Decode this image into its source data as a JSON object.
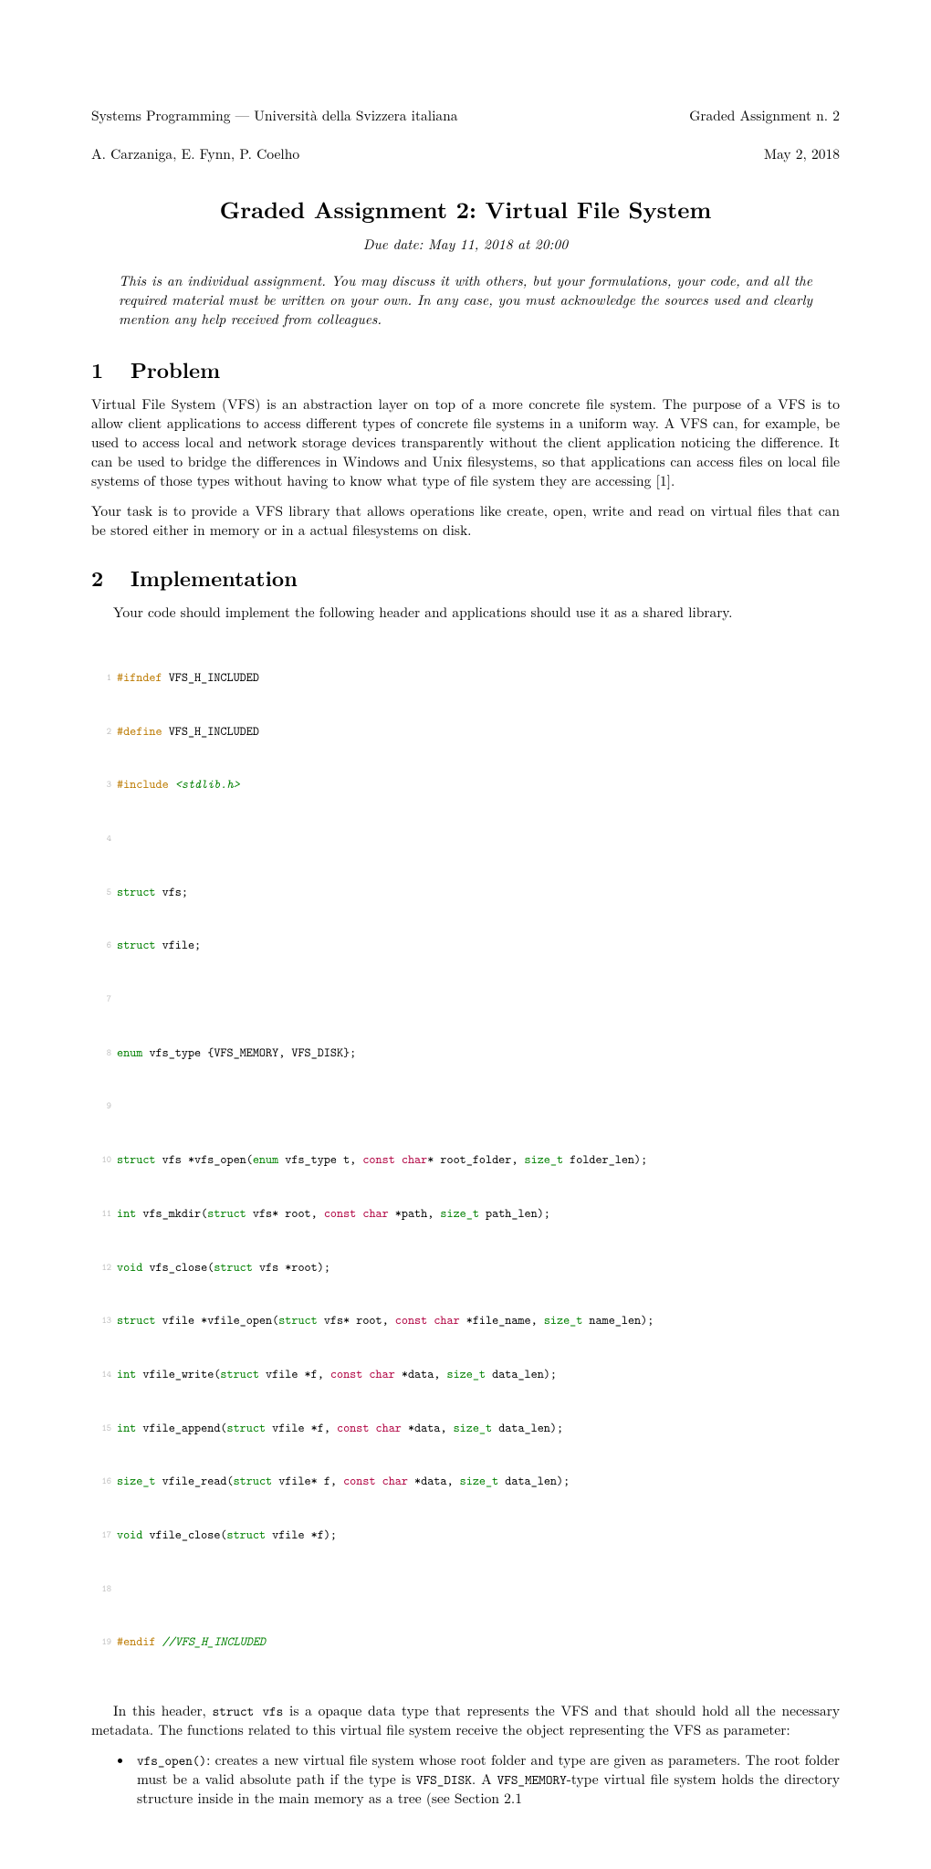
{
  "header": {
    "left_line1": "Systems Programming — Università della Svizzera italiana",
    "left_line2": "A. Carzaniga, E. Fynn, P. Coelho",
    "right_line1": "Graded Assignment n. 2",
    "right_line2": "May 2, 2018"
  },
  "title": "Graded Assignment 2: Virtual File System",
  "due": "Due date: May 11, 2018 at 20:00",
  "notice": "This is an individual assignment. You may discuss it with others, but your formulations, your code, and all the required material must be written on your own. In any case, you must acknowledge the sources used and clearly mention any help received from colleagues.",
  "sections": {
    "s1_num": "1",
    "s1_title": "Problem",
    "s1_p1": "Virtual File System (VFS) is an abstraction layer on top of a more concrete file system. The purpose of a VFS is to allow client applications to access different types of concrete file systems in a uniform way. A VFS can, for example, be used to access local and network storage devices transparently without the client application noticing the difference. It can be used to bridge the differences in Windows and Unix filesystems, so that applications can access files on local file systems of those types without having to know what type of file system they are accessing [1].",
    "s1_p2": "Your task is to provide a VFS library that allows operations like create, open, write and read on virtual files that can be stored either in memory or in a actual filesystems on disk.",
    "s2_num": "2",
    "s2_title": "Implementation",
    "s2_p1": "Your code should implement the following header and applications should use it as a shared library.",
    "s2_p2_a": "In this header, ",
    "s2_p2_b": "struct vfs",
    "s2_p2_c": " is a opaque data type that represents the VFS and that should hold all the necessary metadata. The functions related to this virtual file system receive the object representing the VFS as parameter:"
  },
  "code": {
    "l1": {
      "pre": "#ifndef",
      "rest": " VFS_H_INCLUDED"
    },
    "l2": {
      "pre": "#define",
      "rest": " VFS_H_INCLUDED"
    },
    "l3": {
      "pre": "#include ",
      "inc": "<stdlib.h>"
    },
    "l5a": "struct",
    "l5b": " vfs;",
    "l6a": "struct",
    "l6b": " vfile;",
    "l8a": "enum",
    "l8b": " vfs_type {VFS_MEMORY, VFS_DISK};",
    "l10a": "struct",
    "l10b": " vfs *vfs_open(",
    "l10c": "enum",
    "l10d": " vfs_type t, ",
    "l10e": "const char",
    "l10f": "* root_folder, ",
    "l10g": "size_t",
    "l10h": " folder_len);",
    "l11a": "int",
    "l11b": " vfs_mkdir(",
    "l11c": "struct",
    "l11d": " vfs* root, ",
    "l11e": "const char",
    "l11f": " *path, ",
    "l11g": "size_t",
    "l11h": " path_len);",
    "l12a": "void",
    "l12b": " vfs_close(",
    "l12c": "struct",
    "l12d": " vfs *root);",
    "l13a": "struct",
    "l13b": " vfile *vfile_open(",
    "l13c": "struct",
    "l13d": " vfs* root, ",
    "l13e": "const char",
    "l13f": " *file_name, ",
    "l13g": "size_t",
    "l13h": " name_len);",
    "l14a": "int",
    "l14b": " vfile_write(",
    "l14c": "struct",
    "l14d": " vfile *f, ",
    "l14e": "const char",
    "l14f": " *data, ",
    "l14g": "size_t",
    "l14h": " data_len);",
    "l15a": "int",
    "l15b": " vfile_append(",
    "l15c": "struct",
    "l15d": " vfile *f, ",
    "l15e": "const char",
    "l15f": " *data, ",
    "l15g": "size_t",
    "l15h": " data_len);",
    "l16a": "size_t",
    "l16b": " vfile_read(",
    "l16c": "struct",
    "l16d": " vfile* f, ",
    "l16e": "const char",
    "l16f": " *data, ",
    "l16g": "size_t",
    "l16h": " data_len);",
    "l17a": "void",
    "l17b": " vfile_close(",
    "l17c": "struct",
    "l17d": " vfile *f);",
    "l19a": "#endif ",
    "l19b": "//VFS_H_INCLUDED"
  },
  "bullets": {
    "b1_a": "vfs_open()",
    "b1_b": ": creates a new virtual file system whose root folder and type are given as parameters. The root folder must be a valid absolute path if the type is ",
    "b1_c": "VFS_DISK",
    "b1_d": ". A ",
    "b1_e": "VFS_MEMORY",
    "b1_f": "-type virtual file system holds the directory structure inside in the main memory as a tree (see Section 2.1"
  },
  "line_numbers": [
    "1",
    "2",
    "3",
    "4",
    "5",
    "6",
    "7",
    "8",
    "9",
    "10",
    "11",
    "12",
    "13",
    "14",
    "15",
    "16",
    "17",
    "18",
    "19"
  ]
}
